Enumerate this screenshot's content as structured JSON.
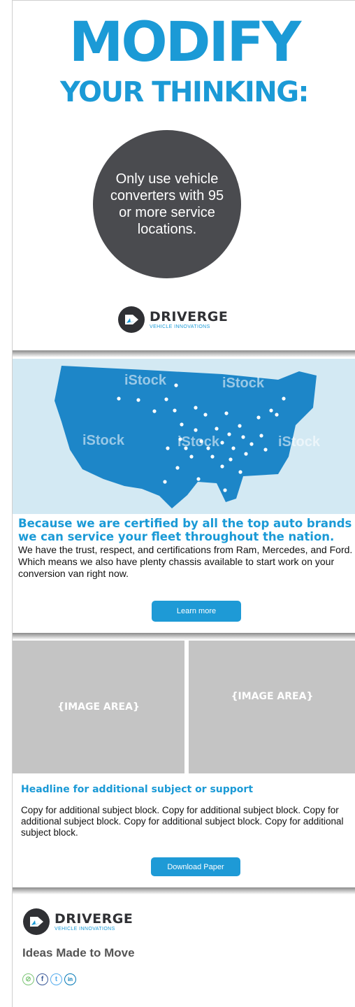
{
  "hero": {
    "title_line1": "MODIFY",
    "title_line2": "YOUR THINKING:",
    "circle_text": "Only use vehicle converters with 95 or more service locations."
  },
  "logo": {
    "brand": "DRIVERGE",
    "tagline": "VEHICLE INNOVATIONS"
  },
  "map": {
    "watermarks": [
      "iStock",
      "iStock",
      "iStock",
      "iStock",
      "iStock"
    ],
    "accent_color": "#1b9ad6"
  },
  "section1": {
    "headline": "Because we are certified by all the top auto brands we can service your fleet throughout the nation.",
    "body": "We have the trust, respect, and certifications from Ram, Mercedes, and Ford. Which means we also have plenty chassis available to start work on your conversion van right now.",
    "button": "Learn more"
  },
  "images": {
    "left_label": "{IMAGE AREA}",
    "right_label": "{IMAGE AREA}"
  },
  "section2": {
    "headline": "Headline for additional subject or support",
    "body": "Copy for additional subject block. Copy for additional subject block. Copy for additional subject block. Copy for additional subject block. Copy for additional subject block.",
    "button": "Download Paper"
  },
  "footer": {
    "tagline": "Ideas Made to Move",
    "socials": [
      {
        "icon": "link-icon",
        "glyph": "⊘",
        "color": "#7cc576"
      },
      {
        "icon": "facebook-icon",
        "glyph": "f",
        "color": "#3b5998"
      },
      {
        "icon": "twitter-icon",
        "glyph": "t",
        "color": "#55acee"
      },
      {
        "icon": "linkedin-icon",
        "glyph": "in",
        "color": "#0077b5"
      }
    ]
  }
}
